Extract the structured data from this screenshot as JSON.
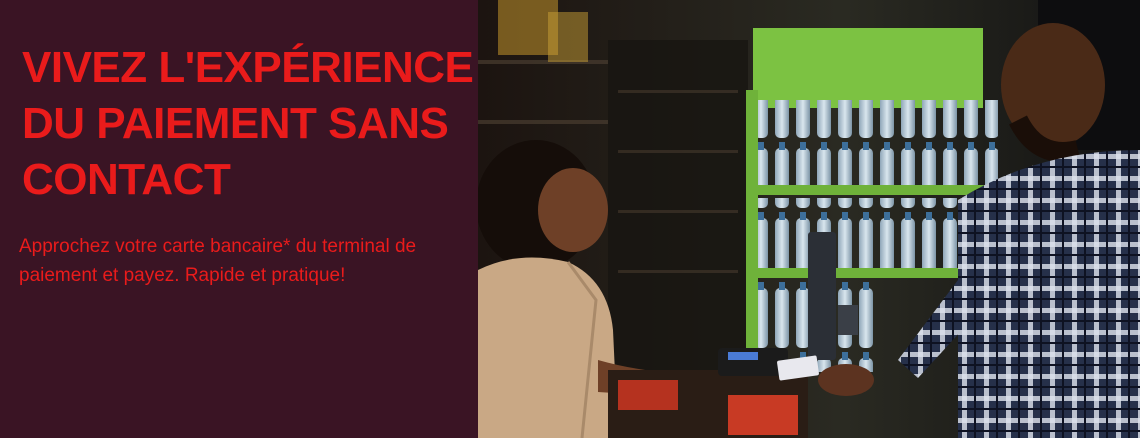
{
  "headline": "VIVEZ L'EXPÉRIENCE\nDU PAIEMENT SANS\nCONTACT",
  "subtext": "Approchez votre carte bancaire* du terminal de paiement et payez. Rapide et pratique!",
  "colors": {
    "panel_background": "#3a1424",
    "text_accent": "#ea1b1b",
    "shelf_green": "#7cc242"
  }
}
